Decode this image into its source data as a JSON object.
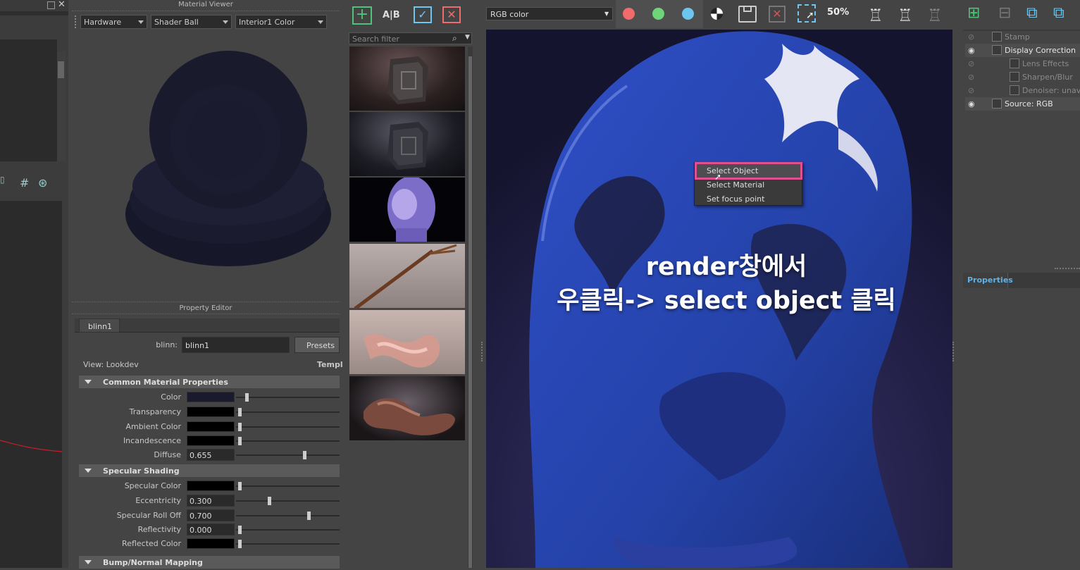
{
  "material_viewer": {
    "title": "Material Viewer",
    "renderer": "Hardware",
    "shape": "Shader Ball",
    "environment": "Interior1 Color"
  },
  "property_editor": {
    "title": "Property Editor",
    "tab": "blinn1",
    "node_type_label": "blinn:",
    "node_name": "blinn1",
    "presets_label": "Presets",
    "view_label": "View: Lookdev",
    "template_label": "Templ",
    "sections": {
      "common": "Common Material Properties",
      "specular": "Specular Shading",
      "bump": "Bump/Normal Mapping"
    },
    "common_rows": [
      {
        "label": "Color",
        "swatch": "#1a1a2e",
        "slider": 0.07
      },
      {
        "label": "Transparency",
        "swatch": "#000000",
        "slider": 0.0
      },
      {
        "label": "Ambient Color",
        "swatch": "#000000",
        "slider": 0.0
      },
      {
        "label": "Incandescence",
        "swatch": "#000000",
        "slider": 0.0
      },
      {
        "label": "Diffuse",
        "value": "0.655",
        "slider": 0.655
      }
    ],
    "specular_rows": [
      {
        "label": "Specular Color",
        "swatch": "#000000",
        "slider": 0.0
      },
      {
        "label": "Eccentricity",
        "value": "0.300",
        "slider": 0.3
      },
      {
        "label": "Specular Roll Off",
        "value": "0.700",
        "slider": 0.7
      },
      {
        "label": "Reflectivity",
        "value": "0.000",
        "slider": 0.0
      },
      {
        "label": "Reflected Color",
        "swatch": "#000000",
        "slider": 0.0
      }
    ]
  },
  "swatch_browser": {
    "search_placeholder": "Search filter"
  },
  "render_view": {
    "channel": "RGB color",
    "zoom": "50",
    "context_menu": [
      "Select Object",
      "Select Material",
      "Set focus point"
    ],
    "highlighted_item": "Select Object",
    "caption_line1": "render창에서",
    "caption_line2": "우클릭-> select object 클릭"
  },
  "layers": {
    "items": [
      {
        "label": "Stamp",
        "visible": false
      },
      {
        "label": "Display Correction",
        "visible": true
      },
      {
        "label": "Lens Effects",
        "visible": false
      },
      {
        "label": "Sharpen/Blur",
        "visible": false
      },
      {
        "label": "Denoiser: unava",
        "visible": false
      },
      {
        "label": "Source: RGB",
        "visible": true
      }
    ],
    "properties_tab": "Properties"
  },
  "colors": {
    "accent": "#e0508e",
    "red_dot": "#f06b6b",
    "green_dot": "#6fd47a",
    "blue_dot": "#6cc6f0",
    "properties_tab": "#5fb1e8"
  }
}
